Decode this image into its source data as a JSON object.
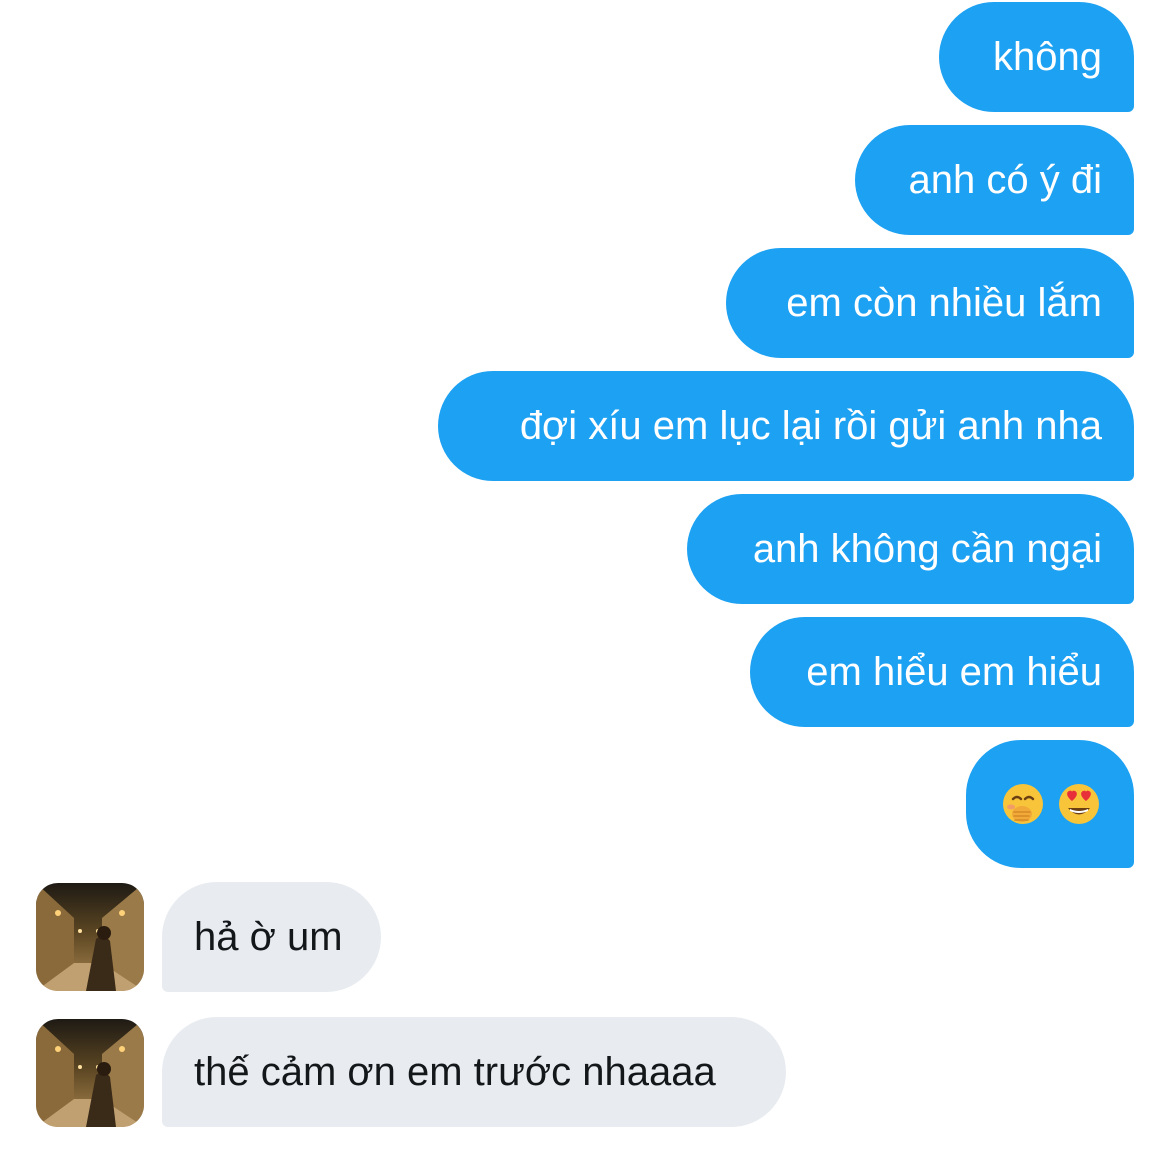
{
  "conversation": {
    "sent": [
      {
        "text": "không"
      },
      {
        "text": "anh có ý đi"
      },
      {
        "text": "em còn nhiều lắm"
      },
      {
        "text": "đợi xíu em lục lại rồi gửi anh nha"
      },
      {
        "text": "anh không cần ngại"
      },
      {
        "text": "em hiểu em hiểu"
      }
    ],
    "sent_emoji": [
      "face-with-hand-over-mouth",
      "smiling-face-with-heart-eyes"
    ],
    "received": [
      {
        "text": "hả ờ um"
      },
      {
        "text": "thế cảm ơn em trước nhaaaa"
      }
    ]
  },
  "colors": {
    "sent_bubble": "#1da1f2",
    "received_bubble": "#e8ecf0",
    "sent_text": "#ffffff",
    "received_text": "#14171a"
  }
}
